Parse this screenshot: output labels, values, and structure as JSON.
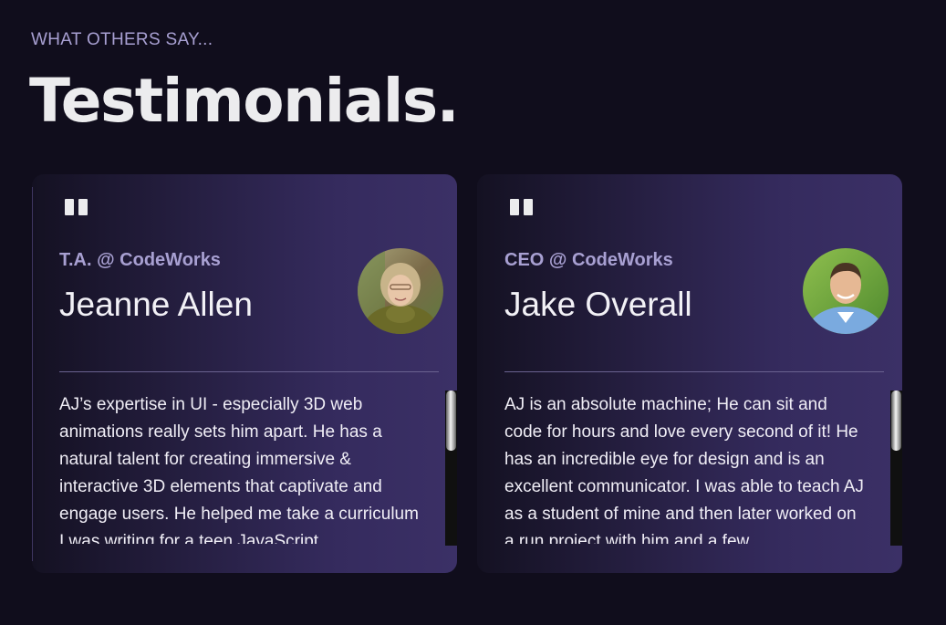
{
  "section": {
    "eyebrow": "WHAT OTHERS SAY...",
    "title": "Testimonials."
  },
  "testimonials": [
    {
      "role": "T.A. @ CodeWorks",
      "name": "Jeanne Allen",
      "quote": "AJ’s expertise in UI - especially 3D web animations really sets him apart. He has a natural talent for creating immersive & interactive 3D elements that captivate and engage users. He helped me take a curriculum I was writing for a teen JavaScript",
      "avatar_icon": "person-photo-icon"
    },
    {
      "role": "CEO @ CodeWorks",
      "name": "Jake Overall",
      "quote": "AJ is an absolute machine; He can sit and code for hours and love every second of it! He has an incredible eye for design and is an excellent communicator. I was able to teach AJ as a student of mine and then later worked on a run project with him and a few",
      "avatar_icon": "person-photo-icon"
    }
  ],
  "colors": {
    "background": "#100d1c",
    "accent_text": "#a8a0d2",
    "card_gradient_end": "#3b3066"
  }
}
